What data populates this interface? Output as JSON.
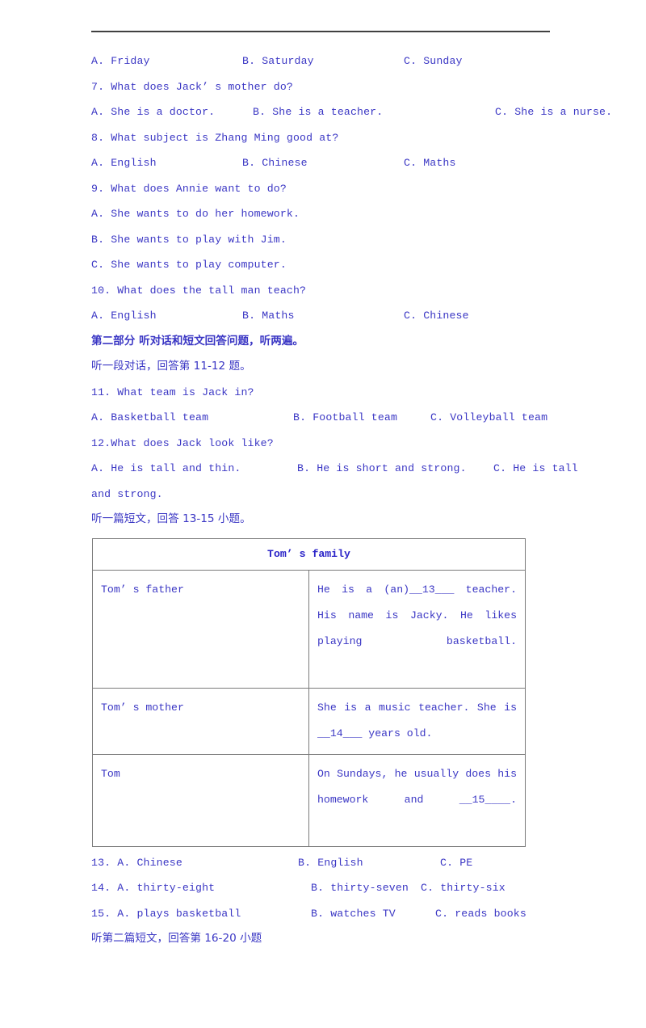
{
  "document": {
    "text_color": "#3a36c4",
    "rule_color": "#404040",
    "table_border_color": "#7a7a7a"
  },
  "questions": [
    {
      "id": "q6-options",
      "options": [
        "A. Friday",
        "B. Saturday",
        "C. Sunday"
      ]
    },
    {
      "id": "q7",
      "stem": "7. What does Jack’ s mother do?",
      "options": [
        "A. She is a doctor.",
        "B. She is a teacher.",
        "C. She is a nurse."
      ]
    },
    {
      "id": "q8",
      "stem": "8. What subject is Zhang Ming good at?",
      "options": [
        "A. English",
        "B. Chinese",
        "C. Maths"
      ]
    },
    {
      "id": "q9",
      "stem": "9. What does Annie want to do?",
      "options_stacked": [
        "A. She wants to do her homework.",
        "B. She wants to play with Jim.",
        "C. She wants to play computer."
      ]
    },
    {
      "id": "q10",
      "stem": "10. What does the tall man teach?",
      "options": [
        "A. English",
        "B. Maths",
        "C. Chinese"
      ]
    }
  ],
  "part_two": {
    "heading": "第二部分 听对话和短文回答问题，听两遍。",
    "dialogue_instruction": "听一段对话，回答第 11-12 题。",
    "q11": {
      "stem": "11. What team is Jack in?",
      "options": [
        "A. Basketball team",
        "B. Football team",
        "C. Volleyball team"
      ]
    },
    "q12": {
      "stem": "12.What does Jack look like?",
      "options": [
        "A. He is tall and thin.",
        "B. He is short and strong.",
        "C. He is tall"
      ],
      "continuation": "and strong."
    },
    "passage_instruction": "听一篇短文，回答 13-15 小题。"
  },
  "family_table": {
    "title": "Tom’ s family",
    "rows": [
      {
        "label": "Tom’ s father",
        "body": "He is a (an)__13___ teacher. His name is Jacky. He likes playing basketball."
      },
      {
        "label": "Tom’ s mother",
        "body": "She is a music teacher. She is __14___ years old."
      },
      {
        "label": "Tom",
        "body": "On Sundays, he usually does his homework and __15____."
      }
    ]
  },
  "questions_13_15": [
    {
      "id": "q13",
      "options": [
        "13. A. Chinese",
        "B. English",
        "C. PE"
      ]
    },
    {
      "id": "q14",
      "options": [
        "14. A. thirty-eight",
        "B. thirty-seven",
        "C. thirty-six"
      ]
    },
    {
      "id": "q15",
      "options": [
        "15. A. plays basketball",
        "B. watches TV",
        "C. reads books"
      ]
    }
  ],
  "footer": {
    "instruction": "听第二篇短文，回答第 16-20 小题"
  }
}
